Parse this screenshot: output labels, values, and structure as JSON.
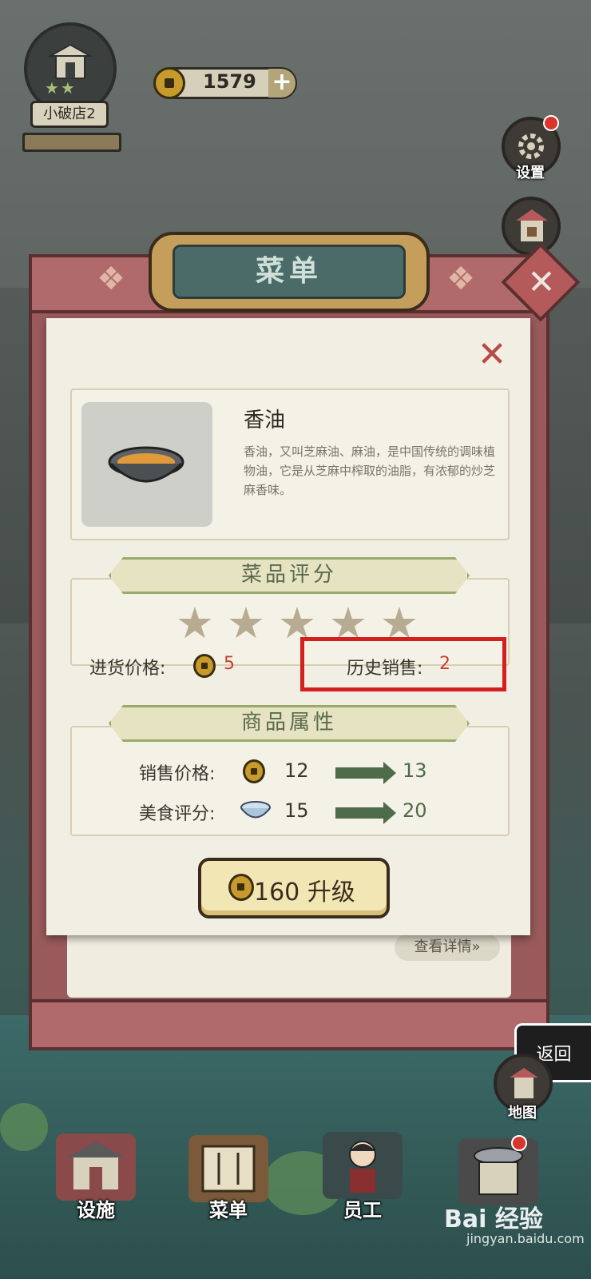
{
  "hud": {
    "shop_name": "小破店2",
    "shop_stars": "★★",
    "coins": "1579",
    "plus": "+"
  },
  "side": {
    "settings": "设置",
    "shop": "商店",
    "map": "地图"
  },
  "menu": {
    "title": "菜单",
    "close": "✕",
    "item": {
      "name": "香油",
      "description": "香油，又叫芝麻油、麻油，是中国传统的调味植物油，它是从芝麻中榨取的油脂，有浓郁的炒芝麻香味。"
    },
    "rating": {
      "header": "菜品评分",
      "stars_filled": 0,
      "stars_total": 5,
      "purchase_price_label": "进货价格:",
      "purchase_price": "5",
      "history_sales_label": "历史销售:",
      "history_sales": "2"
    },
    "attributes": {
      "header": "商品属性",
      "rows": [
        {
          "label": "销售价格:",
          "from": "12",
          "to": "13",
          "icon": "coin-icon"
        },
        {
          "label": "美食评分:",
          "from": "15",
          "to": "20",
          "icon": "bowl-icon"
        }
      ]
    },
    "upgrade": {
      "cost": "160",
      "label": "升级"
    },
    "details_link": "查看详情»"
  },
  "back": "返回",
  "nav": {
    "facilities": "设施",
    "menu": "菜单",
    "staff": "员工"
  },
  "watermark": {
    "brand": "Bai 经验",
    "url": "jingyan.baidu.com"
  },
  "colors": {
    "accent_red": "#c7402f",
    "highlight_box": "#d41f1f",
    "section_green": "#9aaa6a",
    "board_red": "#9a5a5c"
  }
}
